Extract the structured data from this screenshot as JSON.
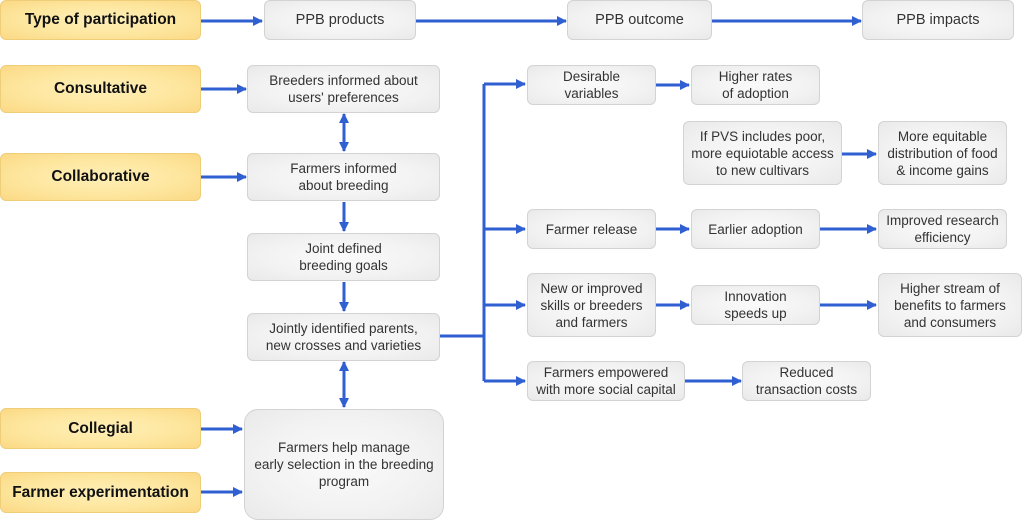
{
  "diagram": {
    "header_row": {
      "type_of_participation": "Type of participation",
      "products": "PPB products",
      "outcome": "PPB outcome",
      "impacts": "PPB impacts"
    },
    "participation_types": {
      "consultative": "Consultative",
      "collaborative": "Collaborative",
      "collegial": "Collegial",
      "farmer_experimentation": "Farmer experimentation"
    },
    "products": {
      "breeders_informed": "Breeders informed about\nusers' preferences",
      "farmers_informed": "Farmers informed\nabout breeding",
      "joint_goals": "Joint defined\nbreeding goals",
      "jointly_identified": "Jointly identified parents,\nnew crosses and varieties",
      "farmers_help_manage": "Farmers help manage\nearly selection in the breeding\nprogram"
    },
    "outcomes": {
      "desirable_variables": "Desirable\nvariables",
      "farmer_release": "Farmer release",
      "new_skills": "New or improved\nskills or breeders\nand farmers",
      "farmers_empowered": "Farmers empowered\nwith more social capital"
    },
    "intermediate": {
      "higher_rates": "Higher rates\nof adoption",
      "pvs_poor": "If PVS includes poor,\nmore equiotable access\nto new cultivars",
      "earlier_adoption": "Earlier adoption",
      "innovation_speeds": "Innovation\nspeeds up",
      "reduced_costs": "Reduced\ntransaction costs"
    },
    "impacts": {
      "equitable_distribution": "More equitable\ndistribution of food\n& income gains",
      "improved_efficiency": "Improved research\nefficiency",
      "higher_stream": "Higher stream of\nbenefits to farmers\nand consumers"
    },
    "colors": {
      "arrow": "#2f5fd0",
      "participation_fill": "#fde59c",
      "node_fill": "#f2f2f2",
      "node_border": "#d3d3d3"
    }
  }
}
